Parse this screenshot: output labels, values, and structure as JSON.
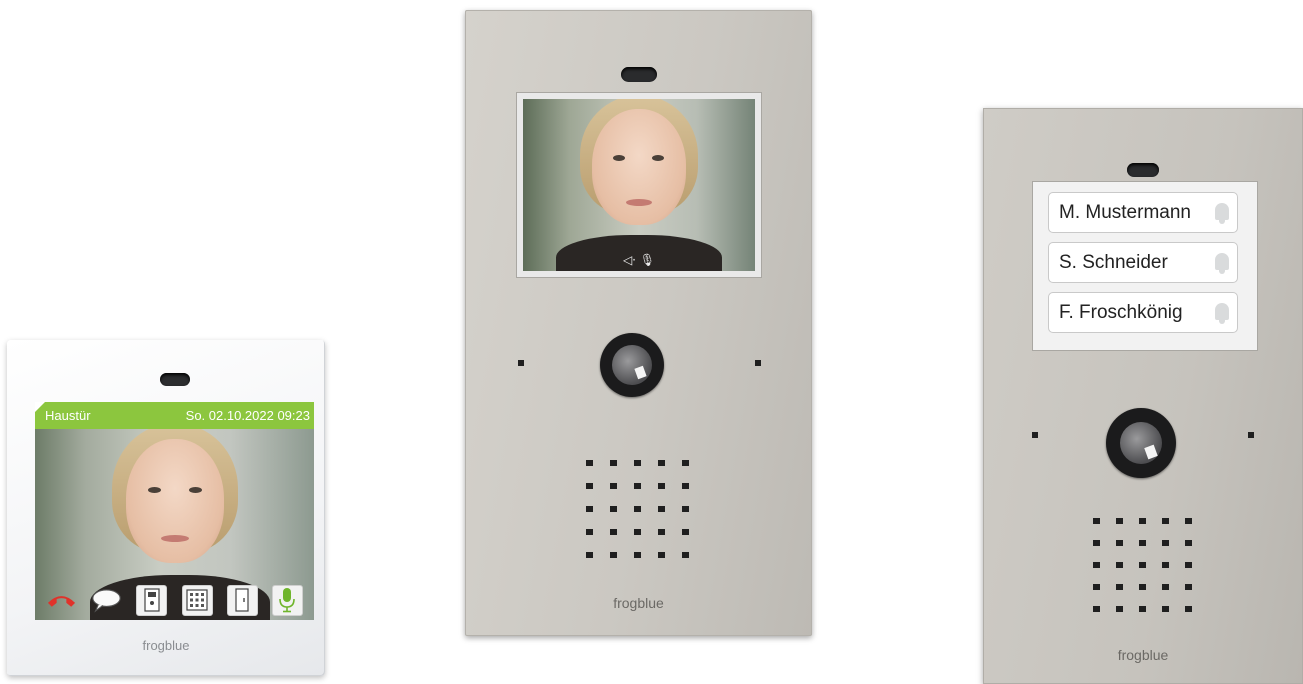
{
  "monitor": {
    "location_label": "Haustür",
    "datetime": "So. 02.10.2022 09:23",
    "brand": "frogblue",
    "icons": [
      "hangup-icon",
      "chat-icon",
      "door-station-icon",
      "keypad-icon",
      "door-icon",
      "microphone-icon"
    ]
  },
  "video_station": {
    "brand": "frogblue",
    "screen_indicators": "◁·   🎙",
    "icons": [
      "speaker-icon",
      "microphone-icon"
    ]
  },
  "name_station": {
    "brand": "frogblue",
    "names": [
      "M. Mustermann",
      "S. Schneider",
      "F. Froschkönig"
    ]
  },
  "colors": {
    "accent_green": "#8cc63e",
    "hangup_red": "#e0322a",
    "panel_silver": "#cbc8c2"
  }
}
